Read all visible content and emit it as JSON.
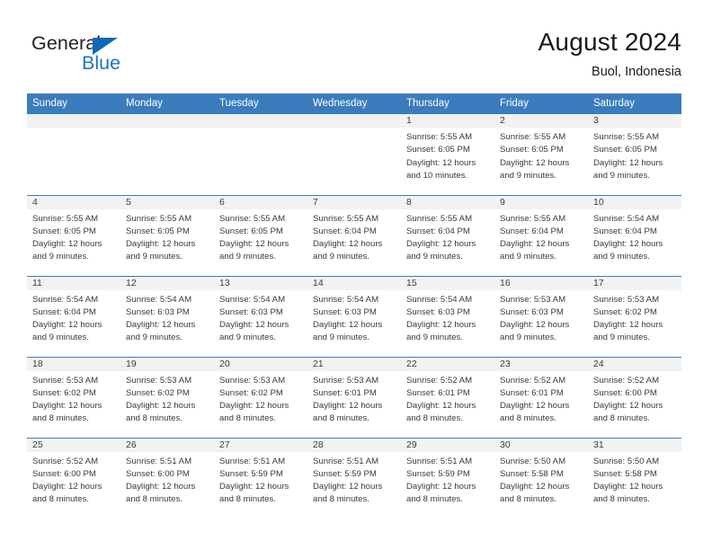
{
  "brand": {
    "name_part1": "General",
    "name_part2": "Blue",
    "icon": "triangle-logo-icon",
    "accent_color": "#1266b5",
    "blue_text_color": "#1a74c4"
  },
  "header": {
    "title": "August 2024",
    "subtitle": "Buol, Indonesia"
  },
  "theme": {
    "header_bar_color": "#3a7cbe",
    "daynum_bar_color": "#f2f2f2",
    "text_color": "#3a3a3a"
  },
  "calendar": {
    "weekday_headers": [
      "Sunday",
      "Monday",
      "Tuesday",
      "Wednesday",
      "Thursday",
      "Friday",
      "Saturday"
    ],
    "weeks": [
      [
        {
          "day": "",
          "empty": true,
          "sunrise": "",
          "sunset": "",
          "daylight_line1": "",
          "daylight_line2": ""
        },
        {
          "day": "",
          "empty": true,
          "sunrise": "",
          "sunset": "",
          "daylight_line1": "",
          "daylight_line2": ""
        },
        {
          "day": "",
          "empty": true,
          "sunrise": "",
          "sunset": "",
          "daylight_line1": "",
          "daylight_line2": ""
        },
        {
          "day": "",
          "empty": true,
          "sunrise": "",
          "sunset": "",
          "daylight_line1": "",
          "daylight_line2": ""
        },
        {
          "day": "1",
          "empty": false,
          "sunrise": "Sunrise: 5:55 AM",
          "sunset": "Sunset: 6:05 PM",
          "daylight_line1": "Daylight: 12 hours",
          "daylight_line2": "and 10 minutes."
        },
        {
          "day": "2",
          "empty": false,
          "sunrise": "Sunrise: 5:55 AM",
          "sunset": "Sunset: 6:05 PM",
          "daylight_line1": "Daylight: 12 hours",
          "daylight_line2": "and 9 minutes."
        },
        {
          "day": "3",
          "empty": false,
          "sunrise": "Sunrise: 5:55 AM",
          "sunset": "Sunset: 6:05 PM",
          "daylight_line1": "Daylight: 12 hours",
          "daylight_line2": "and 9 minutes."
        }
      ],
      [
        {
          "day": "4",
          "empty": false,
          "sunrise": "Sunrise: 5:55 AM",
          "sunset": "Sunset: 6:05 PM",
          "daylight_line1": "Daylight: 12 hours",
          "daylight_line2": "and 9 minutes."
        },
        {
          "day": "5",
          "empty": false,
          "sunrise": "Sunrise: 5:55 AM",
          "sunset": "Sunset: 6:05 PM",
          "daylight_line1": "Daylight: 12 hours",
          "daylight_line2": "and 9 minutes."
        },
        {
          "day": "6",
          "empty": false,
          "sunrise": "Sunrise: 5:55 AM",
          "sunset": "Sunset: 6:05 PM",
          "daylight_line1": "Daylight: 12 hours",
          "daylight_line2": "and 9 minutes."
        },
        {
          "day": "7",
          "empty": false,
          "sunrise": "Sunrise: 5:55 AM",
          "sunset": "Sunset: 6:04 PM",
          "daylight_line1": "Daylight: 12 hours",
          "daylight_line2": "and 9 minutes."
        },
        {
          "day": "8",
          "empty": false,
          "sunrise": "Sunrise: 5:55 AM",
          "sunset": "Sunset: 6:04 PM",
          "daylight_line1": "Daylight: 12 hours",
          "daylight_line2": "and 9 minutes."
        },
        {
          "day": "9",
          "empty": false,
          "sunrise": "Sunrise: 5:55 AM",
          "sunset": "Sunset: 6:04 PM",
          "daylight_line1": "Daylight: 12 hours",
          "daylight_line2": "and 9 minutes."
        },
        {
          "day": "10",
          "empty": false,
          "sunrise": "Sunrise: 5:54 AM",
          "sunset": "Sunset: 6:04 PM",
          "daylight_line1": "Daylight: 12 hours",
          "daylight_line2": "and 9 minutes."
        }
      ],
      [
        {
          "day": "11",
          "empty": false,
          "sunrise": "Sunrise: 5:54 AM",
          "sunset": "Sunset: 6:04 PM",
          "daylight_line1": "Daylight: 12 hours",
          "daylight_line2": "and 9 minutes."
        },
        {
          "day": "12",
          "empty": false,
          "sunrise": "Sunrise: 5:54 AM",
          "sunset": "Sunset: 6:03 PM",
          "daylight_line1": "Daylight: 12 hours",
          "daylight_line2": "and 9 minutes."
        },
        {
          "day": "13",
          "empty": false,
          "sunrise": "Sunrise: 5:54 AM",
          "sunset": "Sunset: 6:03 PM",
          "daylight_line1": "Daylight: 12 hours",
          "daylight_line2": "and 9 minutes."
        },
        {
          "day": "14",
          "empty": false,
          "sunrise": "Sunrise: 5:54 AM",
          "sunset": "Sunset: 6:03 PM",
          "daylight_line1": "Daylight: 12 hours",
          "daylight_line2": "and 9 minutes."
        },
        {
          "day": "15",
          "empty": false,
          "sunrise": "Sunrise: 5:54 AM",
          "sunset": "Sunset: 6:03 PM",
          "daylight_line1": "Daylight: 12 hours",
          "daylight_line2": "and 9 minutes."
        },
        {
          "day": "16",
          "empty": false,
          "sunrise": "Sunrise: 5:53 AM",
          "sunset": "Sunset: 6:03 PM",
          "daylight_line1": "Daylight: 12 hours",
          "daylight_line2": "and 9 minutes."
        },
        {
          "day": "17",
          "empty": false,
          "sunrise": "Sunrise: 5:53 AM",
          "sunset": "Sunset: 6:02 PM",
          "daylight_line1": "Daylight: 12 hours",
          "daylight_line2": "and 9 minutes."
        }
      ],
      [
        {
          "day": "18",
          "empty": false,
          "sunrise": "Sunrise: 5:53 AM",
          "sunset": "Sunset: 6:02 PM",
          "daylight_line1": "Daylight: 12 hours",
          "daylight_line2": "and 8 minutes."
        },
        {
          "day": "19",
          "empty": false,
          "sunrise": "Sunrise: 5:53 AM",
          "sunset": "Sunset: 6:02 PM",
          "daylight_line1": "Daylight: 12 hours",
          "daylight_line2": "and 8 minutes."
        },
        {
          "day": "20",
          "empty": false,
          "sunrise": "Sunrise: 5:53 AM",
          "sunset": "Sunset: 6:02 PM",
          "daylight_line1": "Daylight: 12 hours",
          "daylight_line2": "and 8 minutes."
        },
        {
          "day": "21",
          "empty": false,
          "sunrise": "Sunrise: 5:53 AM",
          "sunset": "Sunset: 6:01 PM",
          "daylight_line1": "Daylight: 12 hours",
          "daylight_line2": "and 8 minutes."
        },
        {
          "day": "22",
          "empty": false,
          "sunrise": "Sunrise: 5:52 AM",
          "sunset": "Sunset: 6:01 PM",
          "daylight_line1": "Daylight: 12 hours",
          "daylight_line2": "and 8 minutes."
        },
        {
          "day": "23",
          "empty": false,
          "sunrise": "Sunrise: 5:52 AM",
          "sunset": "Sunset: 6:01 PM",
          "daylight_line1": "Daylight: 12 hours",
          "daylight_line2": "and 8 minutes."
        },
        {
          "day": "24",
          "empty": false,
          "sunrise": "Sunrise: 5:52 AM",
          "sunset": "Sunset: 6:00 PM",
          "daylight_line1": "Daylight: 12 hours",
          "daylight_line2": "and 8 minutes."
        }
      ],
      [
        {
          "day": "25",
          "empty": false,
          "sunrise": "Sunrise: 5:52 AM",
          "sunset": "Sunset: 6:00 PM",
          "daylight_line1": "Daylight: 12 hours",
          "daylight_line2": "and 8 minutes."
        },
        {
          "day": "26",
          "empty": false,
          "sunrise": "Sunrise: 5:51 AM",
          "sunset": "Sunset: 6:00 PM",
          "daylight_line1": "Daylight: 12 hours",
          "daylight_line2": "and 8 minutes."
        },
        {
          "day": "27",
          "empty": false,
          "sunrise": "Sunrise: 5:51 AM",
          "sunset": "Sunset: 5:59 PM",
          "daylight_line1": "Daylight: 12 hours",
          "daylight_line2": "and 8 minutes."
        },
        {
          "day": "28",
          "empty": false,
          "sunrise": "Sunrise: 5:51 AM",
          "sunset": "Sunset: 5:59 PM",
          "daylight_line1": "Daylight: 12 hours",
          "daylight_line2": "and 8 minutes."
        },
        {
          "day": "29",
          "empty": false,
          "sunrise": "Sunrise: 5:51 AM",
          "sunset": "Sunset: 5:59 PM",
          "daylight_line1": "Daylight: 12 hours",
          "daylight_line2": "and 8 minutes."
        },
        {
          "day": "30",
          "empty": false,
          "sunrise": "Sunrise: 5:50 AM",
          "sunset": "Sunset: 5:58 PM",
          "daylight_line1": "Daylight: 12 hours",
          "daylight_line2": "and 8 minutes."
        },
        {
          "day": "31",
          "empty": false,
          "sunrise": "Sunrise: 5:50 AM",
          "sunset": "Sunset: 5:58 PM",
          "daylight_line1": "Daylight: 12 hours",
          "daylight_line2": "and 8 minutes."
        }
      ]
    ]
  }
}
